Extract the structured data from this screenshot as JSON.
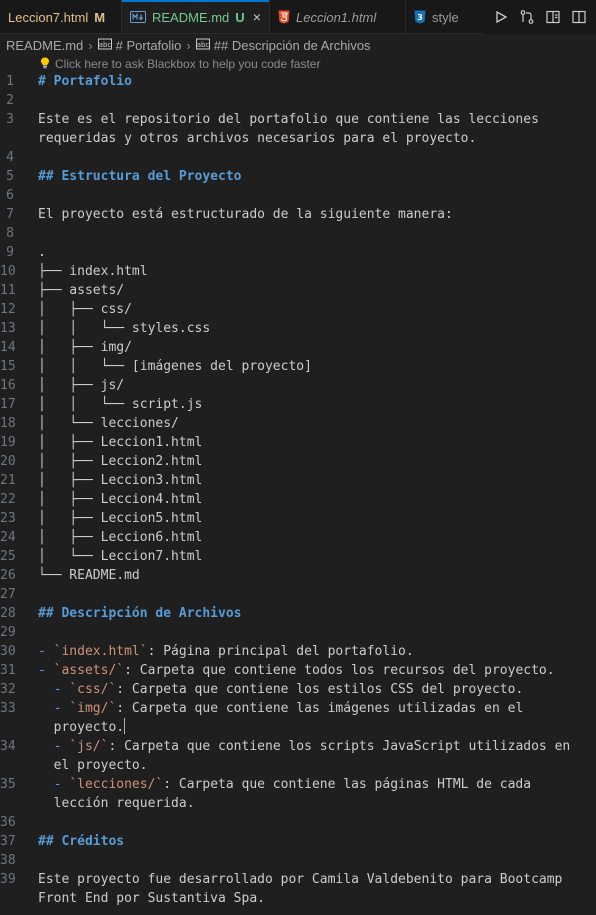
{
  "tabs": [
    {
      "label": "Leccion7.html",
      "status": "M",
      "status_color": "#e2c08d",
      "icon": "none",
      "active": false,
      "italic": false
    },
    {
      "label": "README.md",
      "status": "U",
      "status_color": "#73c991",
      "icon": "markdown-icon",
      "active": true,
      "italic": false,
      "close": "×"
    },
    {
      "label": "Leccion1.html",
      "status": "",
      "icon": "html5-icon",
      "active": false,
      "italic": true
    },
    {
      "label": "style",
      "status": "",
      "icon": "css3-icon",
      "active": false,
      "italic": false
    }
  ],
  "breadcrumb": {
    "file": "README.md",
    "section": "# Portafolio",
    "subsection": "## Descripción de Archivos"
  },
  "hint": "Click here to ask Blackbox to help you code faster",
  "lines": [
    {
      "n": "1",
      "segs": [
        {
          "t": "# Portafolio",
          "c": "heading"
        }
      ]
    },
    {
      "n": "2",
      "segs": []
    },
    {
      "n": "3",
      "segs": [
        {
          "t": "Este es el repositorio del portafolio que contiene las lecciones",
          "c": ""
        }
      ]
    },
    {
      "n": "",
      "segs": [
        {
          "t": "requeridas y otros archivos necesarios para el proyecto.",
          "c": ""
        }
      ]
    },
    {
      "n": "4",
      "segs": []
    },
    {
      "n": "5",
      "segs": [
        {
          "t": "## Estructura del Proyecto",
          "c": "heading"
        }
      ]
    },
    {
      "n": "6",
      "segs": []
    },
    {
      "n": "7",
      "segs": [
        {
          "t": "El proyecto está estructurado de la siguiente manera:",
          "c": ""
        }
      ]
    },
    {
      "n": "8",
      "segs": []
    },
    {
      "n": "9",
      "segs": [
        {
          "t": ".",
          "c": ""
        }
      ]
    },
    {
      "n": "10",
      "segs": [
        {
          "t": "├── index.html",
          "c": "tree"
        }
      ]
    },
    {
      "n": "11",
      "segs": [
        {
          "t": "├── assets/",
          "c": "tree"
        }
      ]
    },
    {
      "n": "12",
      "segs": [
        {
          "t": "│   ├── css/",
          "c": "tree"
        }
      ]
    },
    {
      "n": "13",
      "segs": [
        {
          "t": "│   │   └── styles.css",
          "c": "tree"
        }
      ]
    },
    {
      "n": "14",
      "segs": [
        {
          "t": "│   ├── img/",
          "c": "tree"
        }
      ]
    },
    {
      "n": "15",
      "segs": [
        {
          "t": "│   │   └── [imágenes del proyecto]",
          "c": "tree"
        }
      ]
    },
    {
      "n": "16",
      "segs": [
        {
          "t": "│   ├── js/",
          "c": "tree"
        }
      ]
    },
    {
      "n": "17",
      "segs": [
        {
          "t": "│   │   └── script.js",
          "c": "tree"
        }
      ]
    },
    {
      "n": "18",
      "segs": [
        {
          "t": "│   └── lecciones/",
          "c": "tree"
        }
      ]
    },
    {
      "n": "19",
      "segs": [
        {
          "t": "│   ├── Leccion1.html",
          "c": "tree"
        }
      ]
    },
    {
      "n": "20",
      "segs": [
        {
          "t": "│   ├── Leccion2.html",
          "c": "tree"
        }
      ]
    },
    {
      "n": "21",
      "segs": [
        {
          "t": "│   ├── Leccion3.html",
          "c": "tree"
        }
      ]
    },
    {
      "n": "22",
      "segs": [
        {
          "t": "│   ├── Leccion4.html",
          "c": "tree"
        }
      ]
    },
    {
      "n": "23",
      "segs": [
        {
          "t": "│   ├── Leccion5.html",
          "c": "tree"
        }
      ]
    },
    {
      "n": "24",
      "segs": [
        {
          "t": "│   ├── Leccion6.html",
          "c": "tree"
        }
      ]
    },
    {
      "n": "25",
      "segs": [
        {
          "t": "│   └── Leccion7.html",
          "c": "tree"
        }
      ]
    },
    {
      "n": "26",
      "segs": [
        {
          "t": "└── README.md",
          "c": "tree"
        }
      ]
    },
    {
      "n": "27",
      "segs": []
    },
    {
      "n": "28",
      "segs": [
        {
          "t": "## Descripción de Archivos",
          "c": "heading"
        }
      ]
    },
    {
      "n": "29",
      "segs": []
    },
    {
      "n": "30",
      "segs": [
        {
          "t": "- ",
          "c": "dash"
        },
        {
          "t": "`index.html`",
          "c": "codeinline"
        },
        {
          "t": ": Página principal del portafolio.",
          "c": ""
        }
      ]
    },
    {
      "n": "31",
      "segs": [
        {
          "t": "- ",
          "c": "dash"
        },
        {
          "t": "`assets/`",
          "c": "codeinline"
        },
        {
          "t": ": Carpeta que contiene todos los recursos del proyecto.",
          "c": ""
        }
      ]
    },
    {
      "n": "32",
      "segs": [
        {
          "t": "  - ",
          "c": "dash"
        },
        {
          "t": "`css/`",
          "c": "codeinline"
        },
        {
          "t": ": Carpeta que contiene los estilos CSS del proyecto.",
          "c": ""
        }
      ]
    },
    {
      "n": "33",
      "segs": [
        {
          "t": "  - ",
          "c": "dash"
        },
        {
          "t": "`img/`",
          "c": "codeinline"
        },
        {
          "t": ": Carpeta que contiene las imágenes utilizadas en el",
          "c": ""
        }
      ]
    },
    {
      "n": "",
      "segs": [
        {
          "t": "  proyecto.",
          "c": ""
        }
      ],
      "caret": true
    },
    {
      "n": "34",
      "segs": [
        {
          "t": "  - ",
          "c": "dash"
        },
        {
          "t": "`js/`",
          "c": "codeinline"
        },
        {
          "t": ": Carpeta que contiene los scripts JavaScript utilizados en",
          "c": ""
        }
      ]
    },
    {
      "n": "",
      "segs": [
        {
          "t": "  el proyecto.",
          "c": ""
        }
      ]
    },
    {
      "n": "35",
      "segs": [
        {
          "t": "  - ",
          "c": "dash"
        },
        {
          "t": "`lecciones/`",
          "c": "codeinline"
        },
        {
          "t": ": Carpeta que contiene las páginas HTML de cada",
          "c": ""
        }
      ]
    },
    {
      "n": "",
      "segs": [
        {
          "t": "  lección requerida.",
          "c": ""
        }
      ]
    },
    {
      "n": "36",
      "segs": []
    },
    {
      "n": "37",
      "segs": [
        {
          "t": "## Créditos",
          "c": "heading"
        }
      ]
    },
    {
      "n": "38",
      "segs": []
    },
    {
      "n": "39",
      "segs": [
        {
          "t": "Este proyecto fue desarrollado por Camila Valdebenito para Bootcamp",
          "c": ""
        }
      ]
    },
    {
      "n": "",
      "segs": [
        {
          "t": "Front End por Sustantiva Spa.",
          "c": ""
        }
      ]
    }
  ]
}
